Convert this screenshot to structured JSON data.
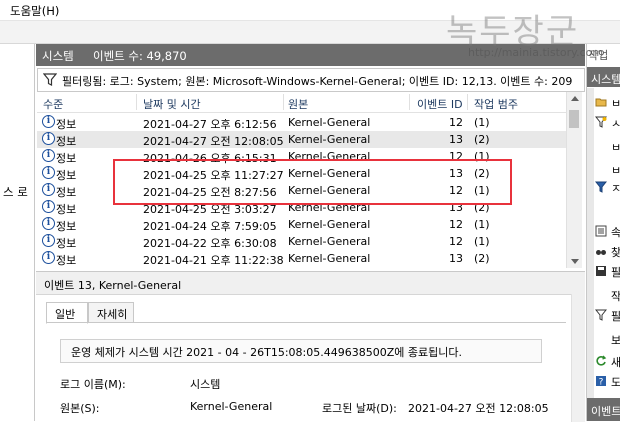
{
  "menubar": {
    "help": "도움말(H)"
  },
  "watermark": {
    "title": "녹두장군",
    "url": "http://mainia.tistory.com",
    "tail": "작업"
  },
  "left_pane": {
    "label": "스 로"
  },
  "log": {
    "title": "시스템",
    "event_count": "이벤트 수: 49,870",
    "filter_text": "필터링됨: 로그: System; 원본: Microsoft-Windows-Kernel-General; 이벤트 ID: 12,13. 이벤트 수: 209"
  },
  "columns": {
    "level": "수준",
    "datetime": "날짜 및 시간",
    "source": "원본",
    "event_id": "이벤트 ID",
    "category": "작업 범주"
  },
  "rows": [
    {
      "level": "정보",
      "datetime": "2021-04-27 오후 6:12:56",
      "source": "Kernel-General",
      "event_id": "12",
      "category": "(1)"
    },
    {
      "level": "정보",
      "datetime": "2021-04-27 오전 12:08:05",
      "source": "Kernel-General",
      "event_id": "13",
      "category": "(2)"
    },
    {
      "level": "정보",
      "datetime": "2021-04-26 오후 6:15:31",
      "source": "Kernel-General",
      "event_id": "12",
      "category": "(1)"
    },
    {
      "level": "정보",
      "datetime": "2021-04-25 오후 11:27:27",
      "source": "Kernel-General",
      "event_id": "13",
      "category": "(2)"
    },
    {
      "level": "정보",
      "datetime": "2021-04-25 오전 8:27:56",
      "source": "Kernel-General",
      "event_id": "12",
      "category": "(1)"
    },
    {
      "level": "정보",
      "datetime": "2021-04-25 오전 3:03:27",
      "source": "Kernel-General",
      "event_id": "13",
      "category": "(2)"
    },
    {
      "level": "정보",
      "datetime": "2021-04-24 오후 7:59:05",
      "source": "Kernel-General",
      "event_id": "12",
      "category": "(1)"
    },
    {
      "level": "정보",
      "datetime": "2021-04-22 오후 6:30:08",
      "source": "Kernel-General",
      "event_id": "12",
      "category": "(1)"
    },
    {
      "level": "정보",
      "datetime": "2021-04-21 오후 11:22:38",
      "source": "Kernel-General",
      "event_id": "13",
      "category": "(2)"
    }
  ],
  "detail": {
    "title": "이벤트 13, Kernel-General",
    "tab_general": "일반",
    "tab_details": "자세히",
    "message": "운영 체제가 시스템 시간   2021   -   04   -   26T15:08:05.449638500Z에 종료됩니다.",
    "log_name_label": "로그 이름(M):",
    "log_name_value": "시스템",
    "source_label": "원본(S):",
    "source_value": "Kernel-General",
    "logged_label": "로그된 날짜(D):",
    "logged_value": "2021-04-27 오전 12:08:05"
  },
  "right_pane": {
    "title": "시스템",
    "bottom": "이벤트"
  },
  "colors": {
    "highlight": "#e8323c",
    "titlebar": "#6c6c6c"
  }
}
